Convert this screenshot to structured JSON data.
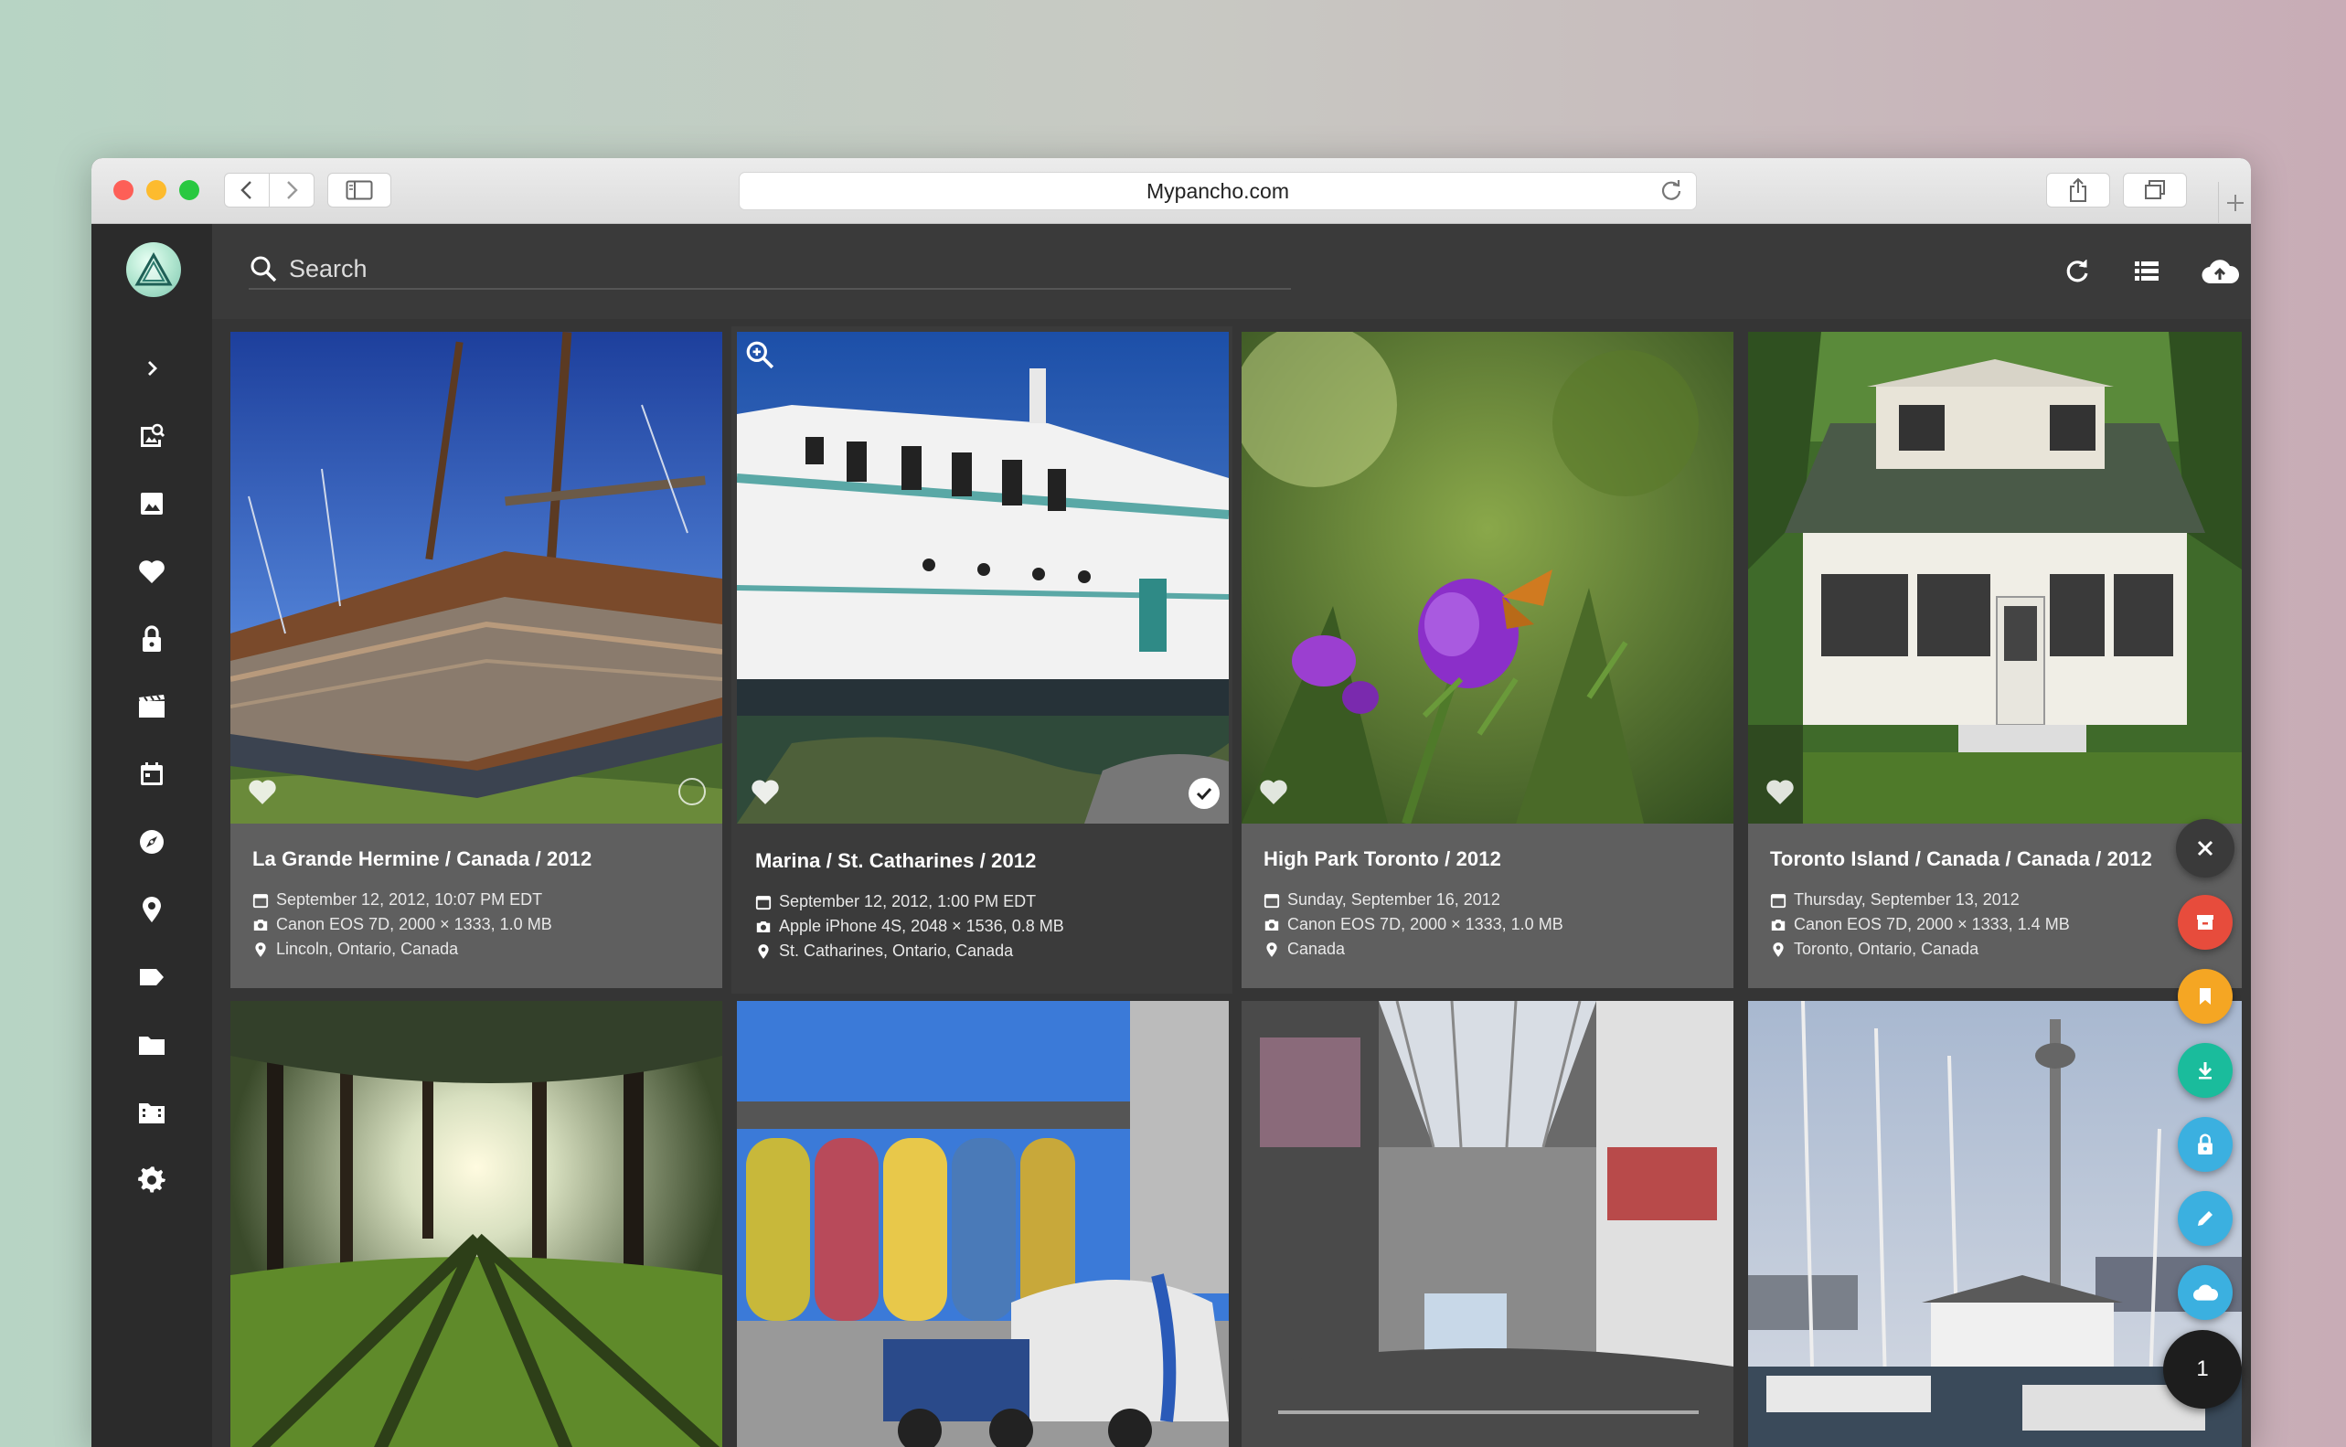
{
  "browser": {
    "url": "Mypancho.com",
    "traffic_lights": [
      "close",
      "minimize",
      "zoom"
    ]
  },
  "colors": {
    "accent_teal": "#4fc4b0",
    "fab_red": "#e74c3c",
    "fab_orange": "#f5a623",
    "fab_green": "#1abc9c",
    "fab_blue": "#3bb0e0",
    "sidebar_bg": "#2b2b2b",
    "topbar_bg": "#3a3a3a"
  },
  "sidebar": {
    "items": [
      {
        "icon": "chevron-right-icon"
      },
      {
        "icon": "image-search-icon"
      },
      {
        "icon": "photo-icon"
      },
      {
        "icon": "heart-icon"
      },
      {
        "icon": "lock-icon"
      },
      {
        "icon": "film-icon"
      },
      {
        "icon": "calendar-icon"
      },
      {
        "icon": "compass-icon"
      },
      {
        "icon": "map-pin-icon"
      },
      {
        "icon": "label-icon"
      },
      {
        "icon": "folder-icon"
      },
      {
        "icon": "folder-film-icon"
      },
      {
        "icon": "gear-icon"
      }
    ]
  },
  "toolbar": {
    "search_placeholder": "Search",
    "icons": [
      "refresh-icon",
      "list-view-icon",
      "cloud-upload-icon",
      "chevron-down-icon"
    ]
  },
  "photos": [
    {
      "title": "La Grande Hermine / Canada / 2012",
      "date": "September 12, 2012, 10:07 PM EDT",
      "camera": "Canon EOS 7D, 2000 × 1333, 1.0 MB",
      "location": "Lincoln, Ontario, Canada",
      "selected": false
    },
    {
      "title": "Marina / St. Catharines / 2012",
      "date": "September 12, 2012, 1:00 PM EDT",
      "camera": "Apple iPhone 4S, 2048 × 1536, 0.8 MB",
      "location": "St. Catharines, Ontario, Canada",
      "selected": true
    },
    {
      "title": "High Park Toronto / 2012",
      "date": "Sunday, September 16, 2012",
      "camera": "Canon EOS 7D, 2000 × 1333, 1.0 MB",
      "location": "Canada",
      "selected": false
    },
    {
      "title": "Toronto Island / Canada / Canada / 2012",
      "date": "Thursday, September 13, 2012",
      "camera": "Canon EOS 7D, 2000 × 1333, 1.4 MB",
      "location": "Toronto, Ontario, Canada",
      "selected": false
    }
  ],
  "fabs": {
    "items": [
      "close-icon",
      "archive-icon",
      "bookmark-icon",
      "download-icon",
      "lock-icon",
      "edit-icon",
      "cloud-icon"
    ],
    "selection_count": "1"
  }
}
